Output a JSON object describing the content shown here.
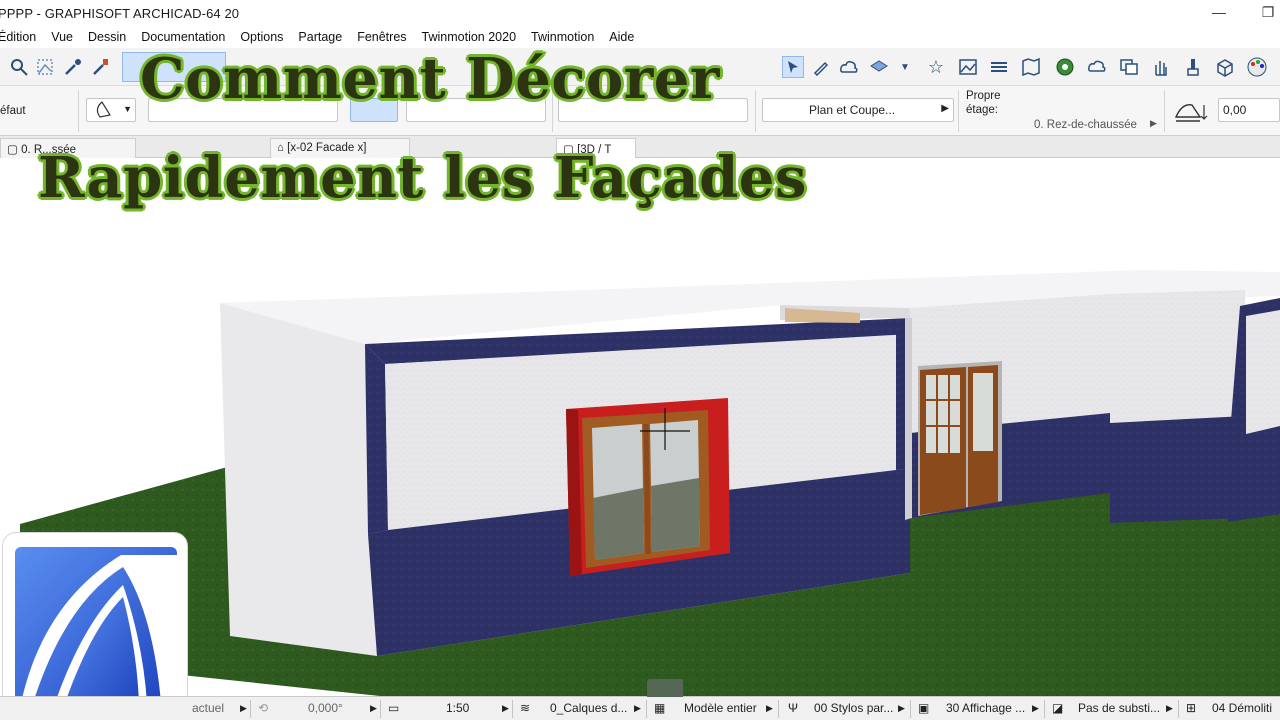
{
  "window": {
    "title": "PPPP - GRAPHISOFT ARCHICAD-64 20",
    "minimize_glyph": "—",
    "restore_glyph": "❐"
  },
  "menu": {
    "items": [
      "Édition",
      "Vue",
      "Dessin",
      "Documentation",
      "Options",
      "Partage",
      "Fenêtres",
      "Twinmotion 2020",
      "Twinmotion",
      "Aide"
    ]
  },
  "toolbar": {
    "icons": [
      "magic-wand-icon",
      "marquee-icon",
      "eyedropper-icon",
      "syringe-icon",
      "arrow-icon",
      "pencil-icon",
      "cloud-icon",
      "layers-icon",
      "star-icon",
      "picture-icon",
      "stack-icon",
      "map-icon",
      "globe-icon",
      "cloud-sync-icon",
      "copy-icon",
      "hand-icon",
      "brush-icon",
      "cube-icon",
      "palette-icon"
    ]
  },
  "infobox": {
    "default_label": "éfaut",
    "view_select": "Plan et Coupe...",
    "story_label_line1": "Propre",
    "story_label_line2": "étage:",
    "story_value": "0. Rez-de-chaussée",
    "elevation_value": "0,00"
  },
  "tabs": [
    {
      "label": "0. R...ssée"
    },
    {
      "label": "[x-02 Facade x]"
    },
    {
      "label": "[3D / T"
    }
  ],
  "headline": {
    "line1": "Comment Décorer",
    "line2": "Rapidement les Façades"
  },
  "status": {
    "cells": [
      {
        "label": "actuel"
      },
      {
        "label": "0,000°"
      },
      {
        "label": "1:50"
      },
      {
        "label": "0_Calques d..."
      },
      {
        "label": "Modèle entier"
      },
      {
        "label": "00 Stylos par..."
      },
      {
        "label": "30 Affichage ..."
      },
      {
        "label": "Pas de substi..."
      },
      {
        "label": "04 Démoliti"
      }
    ]
  },
  "colors": {
    "headline_fill": "#2c3412",
    "headline_outline": "#74b62b",
    "wall_plaster": "#e6e6e8",
    "wall_band": "#2e3166",
    "grass": "#2f5a1f",
    "window_frame": "#c81e1e",
    "wood": "#8b4a1c",
    "logo_blue": "#2d5bd6"
  }
}
